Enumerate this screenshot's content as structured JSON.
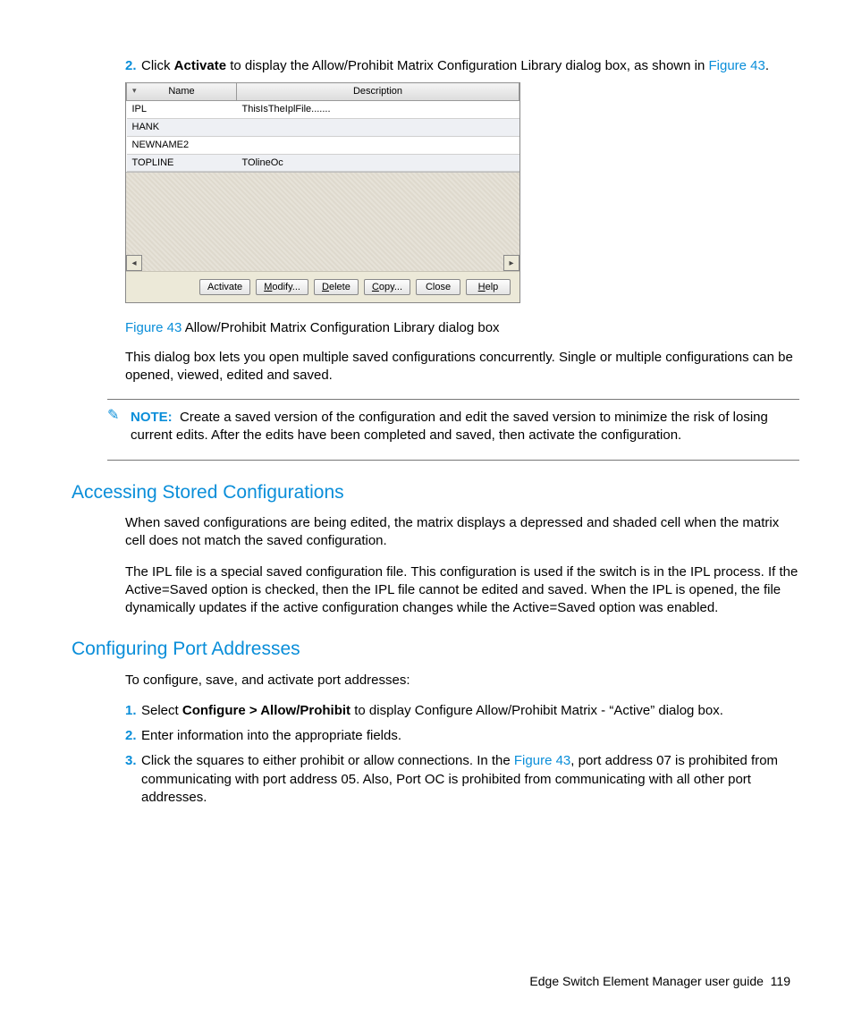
{
  "step2": {
    "num": "2.",
    "pre": "Click ",
    "bold": "Activate",
    "post": " to display the Allow/Prohibit Matrix Configuration Library dialog box, as shown in ",
    "link": "Figure 43",
    "end": "."
  },
  "shot": {
    "headers": {
      "name": "Name",
      "desc": "Description"
    },
    "rows": [
      {
        "name": "IPL",
        "desc": "ThisIsTheIplFile......."
      },
      {
        "name": "HANK",
        "desc": ""
      },
      {
        "name": "NEWNAME2",
        "desc": ""
      },
      {
        "name": "TOPLINE",
        "desc": "TOlineOc"
      }
    ],
    "buttons": {
      "activate": "Activate",
      "modify_pre": "M",
      "modify_post": "odify...",
      "delete_pre": "D",
      "delete_post": "elete",
      "copy_pre": "C",
      "copy_post": "opy...",
      "close": "Close",
      "help_pre": "H",
      "help_post": "elp"
    }
  },
  "caption": {
    "label": "Figure 43",
    "text": " Allow/Prohibit Matrix Configuration Library dialog box"
  },
  "caption_para": "This dialog box lets you open multiple saved configurations concurrently. Single or multiple configurations can be opened, viewed, edited and saved.",
  "note": {
    "label": "NOTE:",
    "text": "Create a saved version of the configuration and edit the saved version to minimize the risk of losing current edits. After the edits have been completed and saved, then activate the configuration."
  },
  "h_access": "Accessing Stored Configurations",
  "access_p1": "When saved configurations are being edited, the matrix displays a depressed and shaded cell when the matrix cell does not match the saved configuration.",
  "access_p2": "The IPL file is a special saved configuration file. This configuration is used if the switch is in the IPL process. If the Active=Saved option is checked, then the IPL file cannot be edited and saved. When the IPL is opened, the file dynamically updates if the active configuration changes while the Active=Saved option was enabled.",
  "h_conf": "Configuring Port Addresses",
  "conf_intro": "To configure, save, and activate port addresses:",
  "conf_s1": {
    "num": "1.",
    "pre": "Select ",
    "bold": "Configure > Allow/Prohibit",
    "post": " to display Configure Allow/Prohibit Matrix - “Active” dialog box."
  },
  "conf_s2": {
    "num": "2.",
    "text": "Enter information into the appropriate fields."
  },
  "conf_s3": {
    "num": "3.",
    "pre": "Click the squares to either prohibit or allow connections. In the ",
    "link": "Figure 43",
    "post": ", port address 07 is prohibited from communicating with port address 05. Also, Port OC is prohibited from communicating with all other port addresses."
  },
  "footer": {
    "text": "Edge Switch Element Manager user guide",
    "page": "119"
  }
}
